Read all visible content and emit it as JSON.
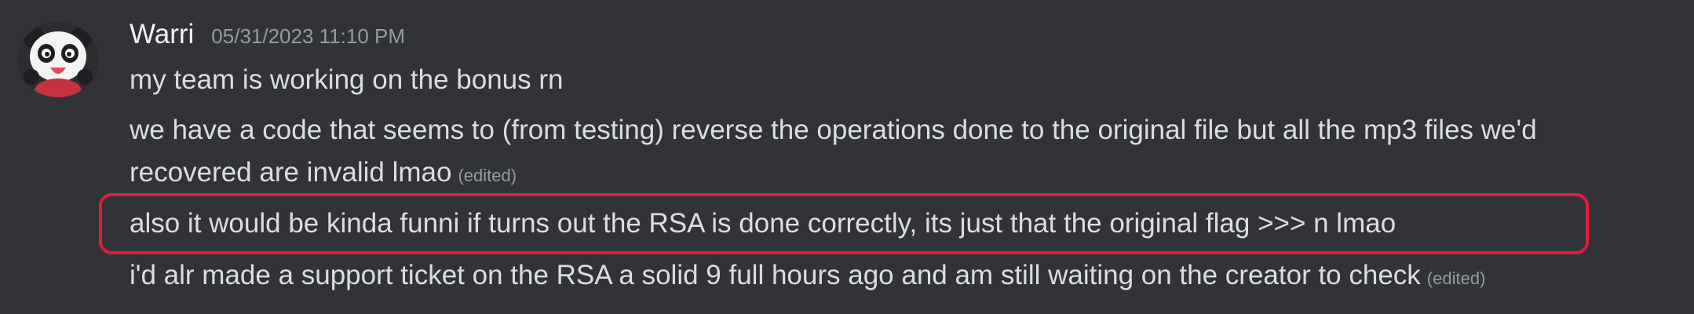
{
  "message": {
    "username": "Warri",
    "timestamp": "05/31/2023 11:10 PM",
    "avatar_icon": "panda-avatar-icon",
    "lines": [
      {
        "text": "my team is working on the bonus rn",
        "edited": ""
      },
      {
        "text": "we have a code that seems to (from testing) reverse the operations done to the original file but all the mp3 files we'd",
        "edited": ""
      },
      {
        "text": "recovered are invalid lmao",
        "edited": "(edited)"
      },
      {
        "text": "also it would be kinda funni if turns out the RSA is done correctly, its just that the original flag >>> n lmao",
        "edited": ""
      },
      {
        "text": "i'd alr made a support ticket on the RSA a solid 9 full hours ago and am still waiting on the creator to check",
        "edited": "(edited)"
      }
    ]
  },
  "colors": {
    "background": "#313338",
    "text": "#dbdee1",
    "username": "#f2f3f5",
    "muted": "#949ba4",
    "highlight": "#e01e37"
  }
}
